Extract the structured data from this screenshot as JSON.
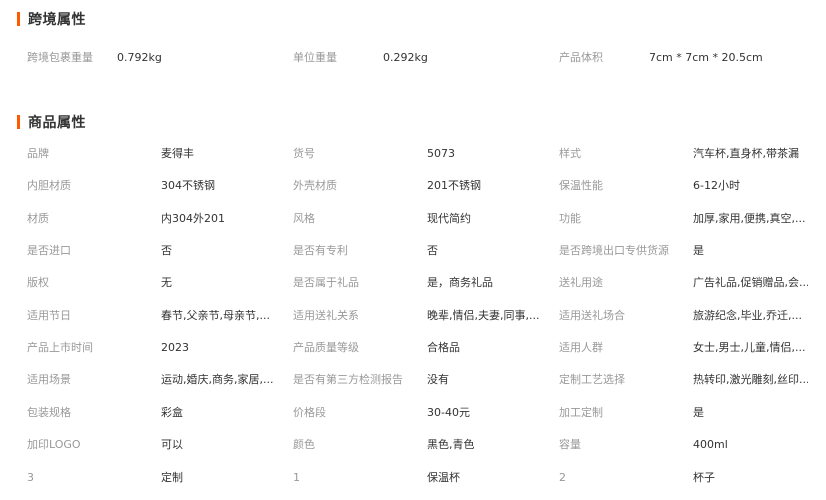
{
  "cross_border": {
    "title": "跨境属性",
    "items": [
      {
        "label": "跨境包裹重量",
        "value": "0.792kg"
      },
      {
        "label": "单位重量",
        "value": "0.292kg"
      },
      {
        "label": "产品体积",
        "value": "7cm * 7cm * 20.5cm"
      }
    ]
  },
  "product": {
    "title": "商品属性",
    "rows": [
      [
        {
          "label": "品牌",
          "value": "麦得丰"
        },
        {
          "label": "货号",
          "value": "5073"
        },
        {
          "label": "样式",
          "value": "汽车杯,直身杯,带茶漏"
        }
      ],
      [
        {
          "label": "内胆材质",
          "value": "304不锈钢"
        },
        {
          "label": "外壳材质",
          "value": "201不锈钢"
        },
        {
          "label": "保温性能",
          "value": "6-12小时"
        }
      ],
      [
        {
          "label": "材质",
          "value": "内304外201"
        },
        {
          "label": "风格",
          "value": "现代简约"
        },
        {
          "label": "功能",
          "value": "加厚,家用,便携,真空,..."
        }
      ],
      [
        {
          "label": "是否进口",
          "value": "否"
        },
        {
          "label": "是否有专利",
          "value": "否"
        },
        {
          "label": "是否跨境出口专供货源",
          "value": "是"
        }
      ],
      [
        {
          "label": "版权",
          "value": "无"
        },
        {
          "label": "是否属于礼品",
          "value": "是，商务礼品"
        },
        {
          "label": "送礼用途",
          "value": "广告礼品,促销赠品,会..."
        }
      ],
      [
        {
          "label": "适用节日",
          "value": "春节,父亲节,母亲节,..."
        },
        {
          "label": "适用送礼关系",
          "value": "晚辈,情侣,夫妻,同事,..."
        },
        {
          "label": "适用送礼场合",
          "value": "旅游纪念,毕业,乔迁,..."
        }
      ],
      [
        {
          "label": "产品上市时间",
          "value": "2023"
        },
        {
          "label": "产品质量等级",
          "value": "合格品"
        },
        {
          "label": "适用人群",
          "value": "女士,男士,儿童,情侣,..."
        }
      ],
      [
        {
          "label": "适用场景",
          "value": "运动,婚庆,商务,家居,..."
        },
        {
          "label": "是否有第三方检测报告",
          "value": "没有"
        },
        {
          "label": "定制工艺选择",
          "value": "热转印,激光雕刻,丝印..."
        }
      ],
      [
        {
          "label": "包装规格",
          "value": "彩盒"
        },
        {
          "label": "价格段",
          "value": "30-40元"
        },
        {
          "label": "加工定制",
          "value": "是"
        }
      ],
      [
        {
          "label": "加印LOGO",
          "value": "可以"
        },
        {
          "label": "颜色",
          "value": "黑色,青色"
        },
        {
          "label": "容量",
          "value": "400ml"
        }
      ],
      [
        {
          "label": "3",
          "value": "定制"
        },
        {
          "label": "1",
          "value": "保温杯"
        },
        {
          "label": "2",
          "value": "杯子"
        }
      ]
    ]
  }
}
